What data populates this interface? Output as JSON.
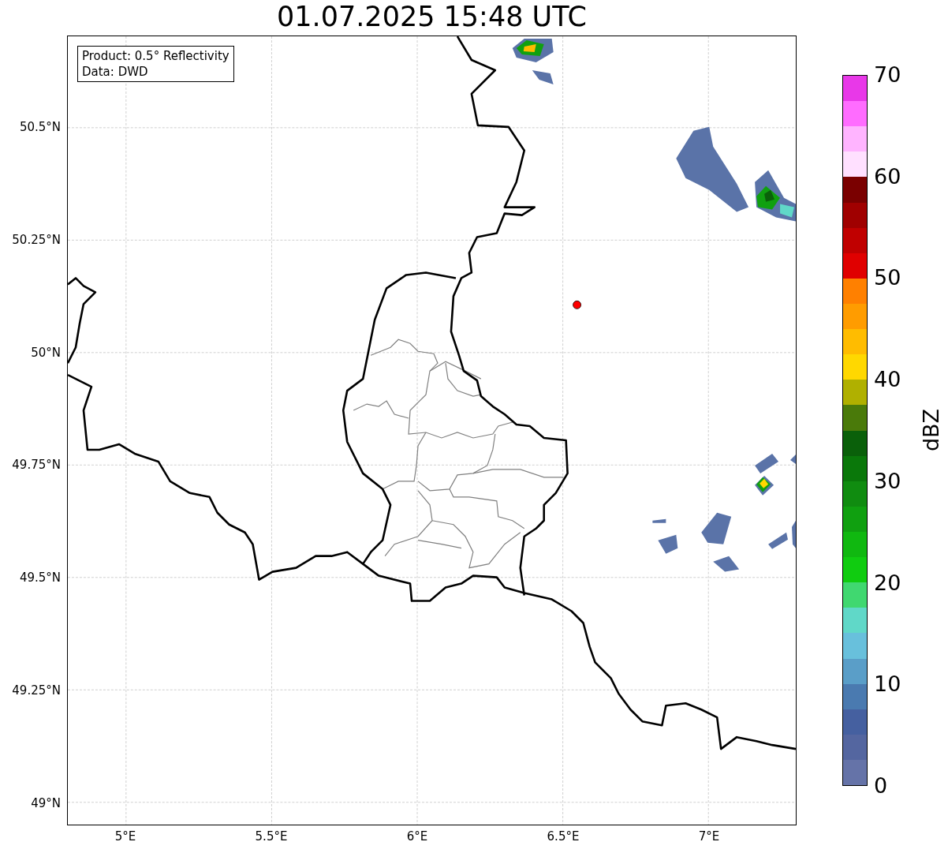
{
  "title": "01.07.2025 15:48 UTC",
  "info_box": {
    "lines": [
      "Product: 0.5° Reflectivity",
      "Data: DWD"
    ]
  },
  "map": {
    "lat_ticks": [
      "50.5°N",
      "50.25°N",
      "50°N",
      "49.75°N",
      "49.5°N",
      "49.25°N",
      "49°N"
    ],
    "lon_ticks": [
      "5°E",
      "5.5°E",
      "6°E",
      "6.5°E",
      "7°E"
    ]
  },
  "colorbar": {
    "label": "dBZ",
    "ticks": [
      "70",
      "60",
      "50",
      "40",
      "30",
      "20",
      "10",
      "0"
    ],
    "segments": [
      {
        "color": "#e838e8"
      },
      {
        "color": "#ff6cff"
      },
      {
        "color": "#ffb4ff"
      },
      {
        "color": "#ffe0ff"
      },
      {
        "color": "#7a0000"
      },
      {
        "color": "#a00000"
      },
      {
        "color": "#c00000"
      },
      {
        "color": "#e00000"
      },
      {
        "color": "#ff8000"
      },
      {
        "color": "#ff9c00"
      },
      {
        "color": "#ffbc00"
      },
      {
        "color": "#ffd800"
      },
      {
        "color": "#b0b000"
      },
      {
        "color": "#4a7a0a"
      },
      {
        "color": "#0a600a"
      },
      {
        "color": "#0a780a"
      },
      {
        "color": "#108c10"
      },
      {
        "color": "#10a010"
      },
      {
        "color": "#10b810"
      },
      {
        "color": "#10cc10"
      },
      {
        "color": "#40d870"
      },
      {
        "color": "#60d8c8"
      },
      {
        "color": "#68c0dc"
      },
      {
        "color": "#5a9ec8"
      },
      {
        "color": "#4a7ab0"
      },
      {
        "color": "#4560a0"
      },
      {
        "color": "#5466a0"
      },
      {
        "color": "#6573a8"
      }
    ]
  }
}
